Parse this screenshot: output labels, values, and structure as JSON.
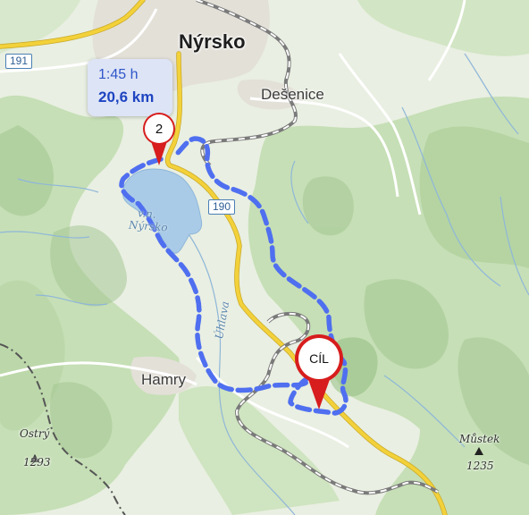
{
  "towns": {
    "nyrsko": "Nýrsko",
    "desenice": "Dešenice",
    "hamry": "Hamry"
  },
  "water": {
    "reservoir_line1": "v.n.",
    "reservoir_line2": "Nýrsko",
    "river": "Úhlava"
  },
  "roads": {
    "shield_191": "191",
    "shield_190": "190"
  },
  "peaks": [
    {
      "name": "Ostrý",
      "elevation": "1293"
    },
    {
      "name": "Můstek",
      "elevation": "1235"
    }
  ],
  "route_tooltip": {
    "duration": "1:45 h",
    "distance": "20,6 km"
  },
  "markers": {
    "waypoint": "2",
    "finish": "CÍL"
  },
  "colors": {
    "route": "#4f6ff0",
    "marker_red": "#d71d1d",
    "road_yellow": "#f3d13a",
    "water": "#a9cbe7",
    "railway": "#8a8a8a"
  },
  "icons": {
    "peak": "peak-triangle-icon",
    "pin": "map-pin-icon"
  }
}
